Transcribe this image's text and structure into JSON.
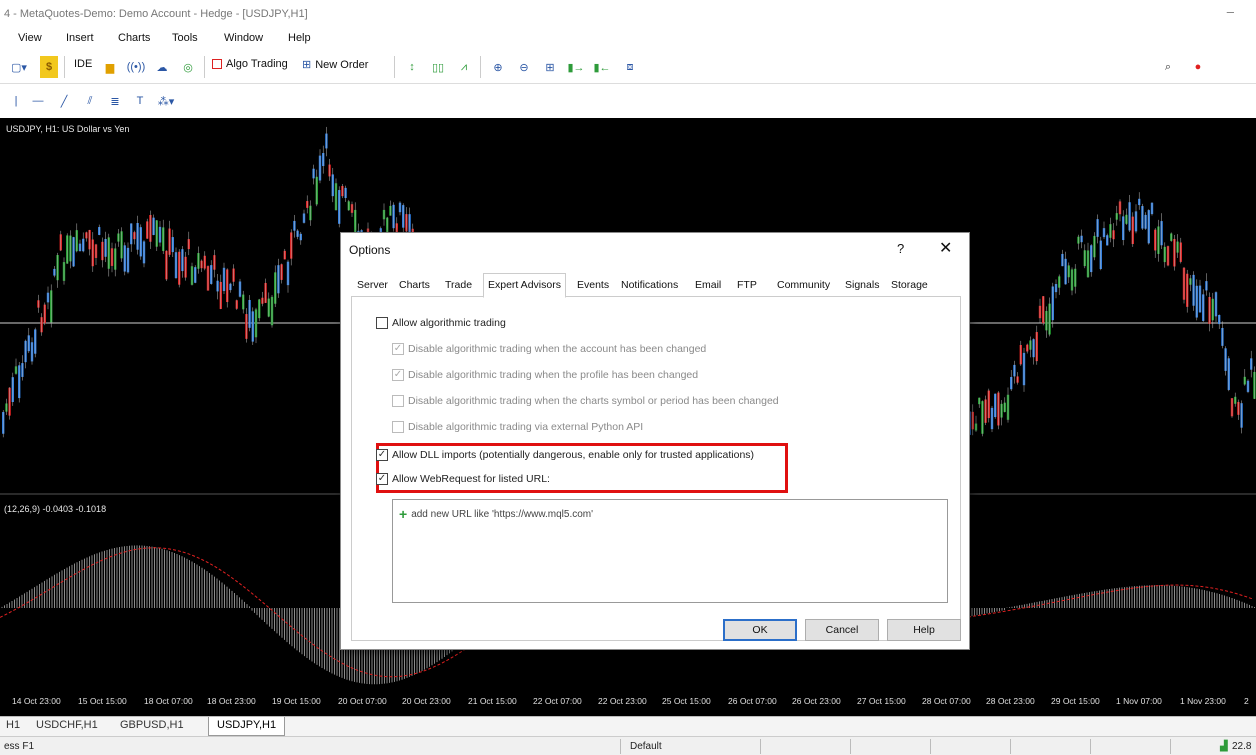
{
  "window": {
    "title": "4 - MetaQuotes-Demo: Demo Account - Hedge - [USDJPY,H1]",
    "minimize": "–"
  },
  "menu": [
    "View",
    "Insert",
    "Charts",
    "Tools",
    "Window",
    "Help"
  ],
  "toolbar": {
    "ide": "IDE",
    "algo_trading": "Algo Trading",
    "new_order": "New Order"
  },
  "chart": {
    "title": "USDJPY, H1:  US Dollar vs Yen",
    "indicator_label": "(12,26,9) -0.0403 -0.1018",
    "time_ticks": [
      "14 Oct 23:00",
      "15 Oct 15:00",
      "18 Oct 07:00",
      "18 Oct 23:00",
      "19 Oct 15:00",
      "20 Oct 07:00",
      "20 Oct 23:00",
      "21 Oct 15:00",
      "22 Oct 07:00",
      "22 Oct 23:00",
      "25 Oct 15:00",
      "26 Oct 07:00",
      "26 Oct 23:00",
      "27 Oct 15:00",
      "28 Oct 07:00",
      "28 Oct 23:00",
      "29 Oct 15:00",
      "1 Nov 07:00",
      "1 Nov 23:00",
      "2"
    ],
    "colors": {
      "bull": "#2d7de0",
      "bear": "#e02020",
      "neutral": "#22a030",
      "background": "#000000"
    }
  },
  "chart_tabs": [
    "H1",
    "USDCHF,H1",
    "GBPUSD,H1",
    "USDJPY,H1"
  ],
  "status": {
    "help": "ess F1",
    "profile": "Default",
    "signal": "22.8"
  },
  "dialog": {
    "title": "Options",
    "help": "?",
    "close": "✕",
    "tabs": [
      "Server",
      "Charts",
      "Trade",
      "Expert Advisors",
      "Events",
      "Notifications",
      "Email",
      "FTP",
      "Community",
      "Signals",
      "Storage"
    ],
    "active_tab": "Expert Advisors",
    "options": [
      {
        "label": "Allow algorithmic trading",
        "checked": false,
        "enabled": true
      },
      {
        "label": "Disable algorithmic trading when the account has been changed",
        "checked": true,
        "enabled": false
      },
      {
        "label": "Disable algorithmic trading when the profile has been changed",
        "checked": true,
        "enabled": false
      },
      {
        "label": "Disable algorithmic trading when the charts symbol or period has been changed",
        "checked": false,
        "enabled": false
      },
      {
        "label": "Disable algorithmic trading via external Python API",
        "checked": false,
        "enabled": false
      },
      {
        "label": "Allow DLL imports (potentially dangerous, enable only for trusted applications)",
        "checked": true,
        "enabled": true
      },
      {
        "label": "Allow WebRequest for listed URL:",
        "checked": true,
        "enabled": true
      }
    ],
    "url_placeholder": "add new URL like 'https://www.mql5.com'",
    "buttons": {
      "ok": "OK",
      "cancel": "Cancel",
      "help": "Help"
    }
  }
}
